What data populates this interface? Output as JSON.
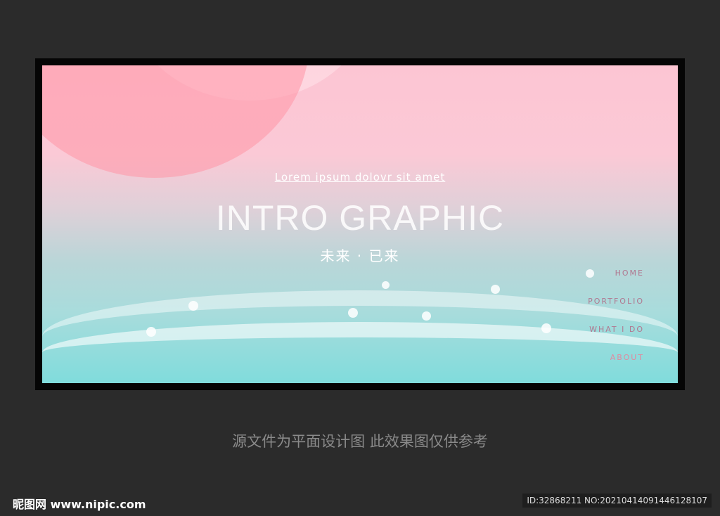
{
  "banner": {
    "subtitle": "Lorem ipsum dolovr sit amet",
    "title": "INTRO GRAPHIC",
    "chinese_subtitle": "未来 · 已来",
    "nav": [
      "HOME",
      "PORTFOLIO",
      "WHAT I DO",
      "ABOUT"
    ]
  },
  "caption": "源文件为平面设计图 此效果图仅供参考",
  "watermark": {
    "logo": "昵图网 www.nipic.com",
    "id": "ID:32868211 NO:20210414091446128107"
  }
}
